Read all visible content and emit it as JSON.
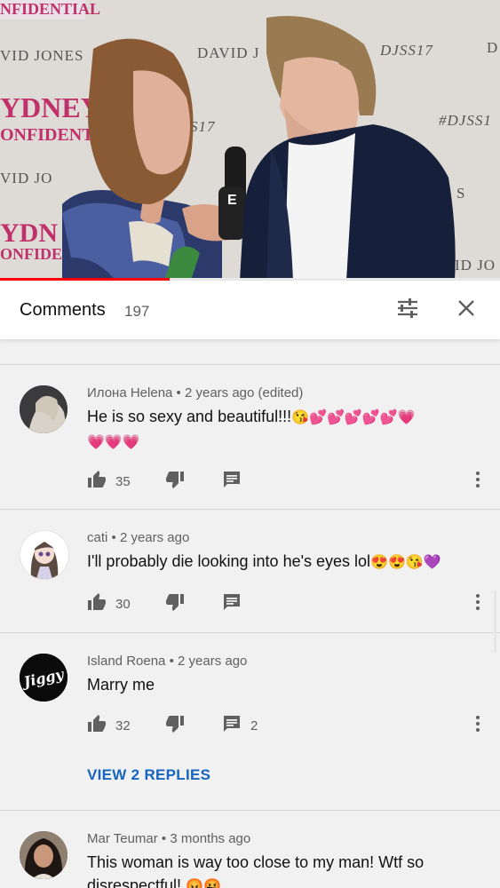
{
  "video": {
    "backdrop_text": [
      "NFIDENTIAL",
      "VID JONES",
      "DAVID J",
      "DJSS17",
      "YDNEY",
      "ONFIDENTIA",
      "S17",
      "#DJSS1",
      "VID JO",
      "YDN",
      "ONFIDEN",
      "ID JO",
      "D",
      "S"
    ],
    "mic_letter": "E",
    "progress_fraction": 0.34
  },
  "header": {
    "title": "Comments",
    "count": "197"
  },
  "comments": [
    {
      "author": "Илона Helena",
      "age": "2 years ago",
      "edited": "(edited)",
      "text": "He is so sexy and beautiful!!!",
      "emoji_line1": "😘💕💕💕💕💕💗",
      "emoji_line2": "💗💗💗",
      "likes": "35",
      "replies_count": ""
    },
    {
      "author": "cati",
      "age": "2 years ago",
      "edited": "",
      "text": "I'll probably die looking into he's eyes lol",
      "emoji_line1": "😍😍😘💜",
      "likes": "30",
      "replies_count": ""
    },
    {
      "author": "Island Roena",
      "age": "2 years ago",
      "edited": "",
      "text": "Marry me",
      "avatar_text": "Jiggy",
      "likes": "32",
      "replies_count": "2",
      "view_replies": "VIEW 2 REPLIES"
    },
    {
      "author": "Mar Teumar",
      "age": "3 months ago",
      "edited": "",
      "text": "This woman is way too close to my man! Wtf so disrespectful!",
      "emoji_line1": "😡🤬"
    }
  ],
  "icons": {
    "filter": "sliders-icon",
    "close": "close-icon",
    "like": "thumbs-up-icon",
    "dislike": "thumbs-down-icon",
    "reply": "comment-icon",
    "more": "more-vert-icon"
  },
  "colors": {
    "accent_red": "#ff0000",
    "link_blue": "#1565c0",
    "text": "#111111",
    "meta": "#606060"
  }
}
